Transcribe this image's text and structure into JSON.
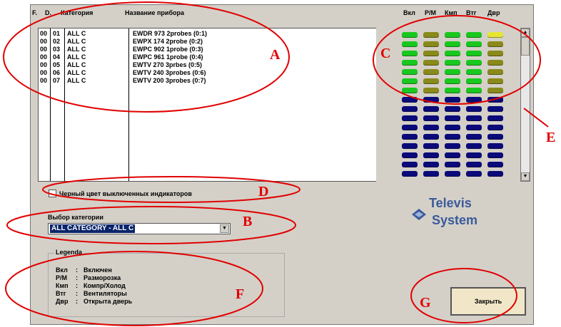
{
  "table": {
    "headers": [
      "F.",
      "D.",
      "Категория",
      "Название прибора"
    ],
    "rows": [
      [
        "00",
        "01",
        "ALL C",
        "EWDR 973 2probes (0:1)"
      ],
      [
        "00",
        "02",
        "ALL C",
        "EWPX 174 2probe (0:2)"
      ],
      [
        "00",
        "03",
        "ALL C",
        "EWPC 902 1probe (0:3)"
      ],
      [
        "00",
        "04",
        "ALL C",
        "EWPC 961 1probe (0:4)"
      ],
      [
        "00",
        "05",
        "ALL C",
        "EWTV 270 3prbes (0:5)"
      ],
      [
        "00",
        "06",
        "ALL C",
        "EWTV 240 3probes (0:6)"
      ],
      [
        "00",
        "07",
        "ALL C",
        "EWTV 200 3probes (0:7)"
      ]
    ]
  },
  "indicators": {
    "headers": [
      "Вкл",
      "Р/М",
      "Кмп",
      "Втг",
      "Двр"
    ],
    "active_rows": [
      [
        "green",
        "olive",
        "green",
        "green",
        "yellow"
      ],
      [
        "green",
        "olive",
        "green",
        "green",
        "olive"
      ],
      [
        "green",
        "olive",
        "green",
        "green",
        "olive"
      ],
      [
        "green",
        "olive",
        "green",
        "green",
        "olive"
      ],
      [
        "green",
        "olive",
        "green",
        "green",
        "olive"
      ],
      [
        "green",
        "olive",
        "green",
        "green",
        "olive"
      ],
      [
        "green",
        "olive",
        "green",
        "green",
        "olive"
      ]
    ],
    "inactive_row_count": 9,
    "colors": {
      "green": "#19c81e",
      "olive": "#8a8a1c",
      "yellow": "#e6e632",
      "off": "#0a0a7a"
    }
  },
  "checkbox_label": "Черный цвет выключенных индикаторов",
  "category": {
    "label": "Выбор категории",
    "value": "ALL CATEGORY - ALL C"
  },
  "logo": {
    "line1": "Televis",
    "line2": "System"
  },
  "legend": {
    "title": "Legenda",
    "items": [
      {
        "key": "Вкл",
        "sep": ":",
        "text": "Включен"
      },
      {
        "key": "Р/М",
        "sep": ":",
        "text": "Разморозка"
      },
      {
        "key": "Кмп",
        "sep": ":",
        "text": "Компр/Холод"
      },
      {
        "key": "Втг",
        "sep": ":",
        "text": "Вентиляторы"
      },
      {
        "key": "Двр",
        "sep": ":",
        "text": "Открыта дверь"
      }
    ]
  },
  "close_button": "Закрыть",
  "annotations": [
    "A",
    "B",
    "C",
    "D",
    "E",
    "F",
    "G"
  ]
}
